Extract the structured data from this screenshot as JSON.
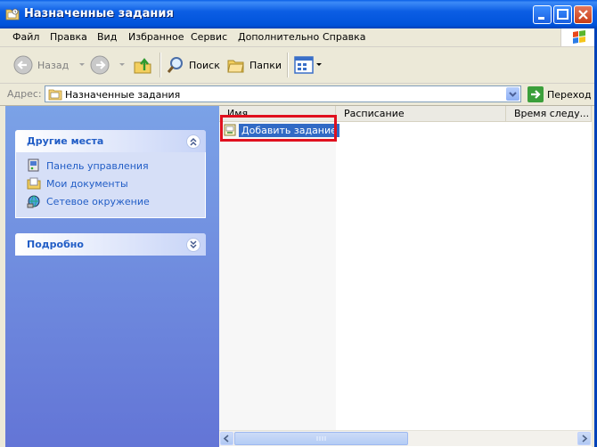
{
  "window": {
    "title": "Назначенные задания"
  },
  "menu": [
    "Файл",
    "Правка",
    "Вид",
    "Избранное",
    "Сервис",
    "Дополнительно",
    "Справка"
  ],
  "toolbar": {
    "back": "Назад",
    "search": "Поиск",
    "folders": "Папки"
  },
  "address": {
    "label": "Адрес:",
    "value": "Назначенные задания",
    "go": "Переход"
  },
  "other_places": {
    "title": "Другие места",
    "links": [
      "Панель управления",
      "Мои документы",
      "Сетевое окружение"
    ]
  },
  "details": {
    "title": "Подробно"
  },
  "list": {
    "columns": [
      "Имя",
      "Расписание",
      "Время следу..."
    ],
    "items": [
      "Добавить задание"
    ]
  },
  "colors": {
    "title_blue": "#0053DA",
    "link": "#215DC6",
    "selection": "#316AC5",
    "highlight_frame": "#E0101E"
  }
}
